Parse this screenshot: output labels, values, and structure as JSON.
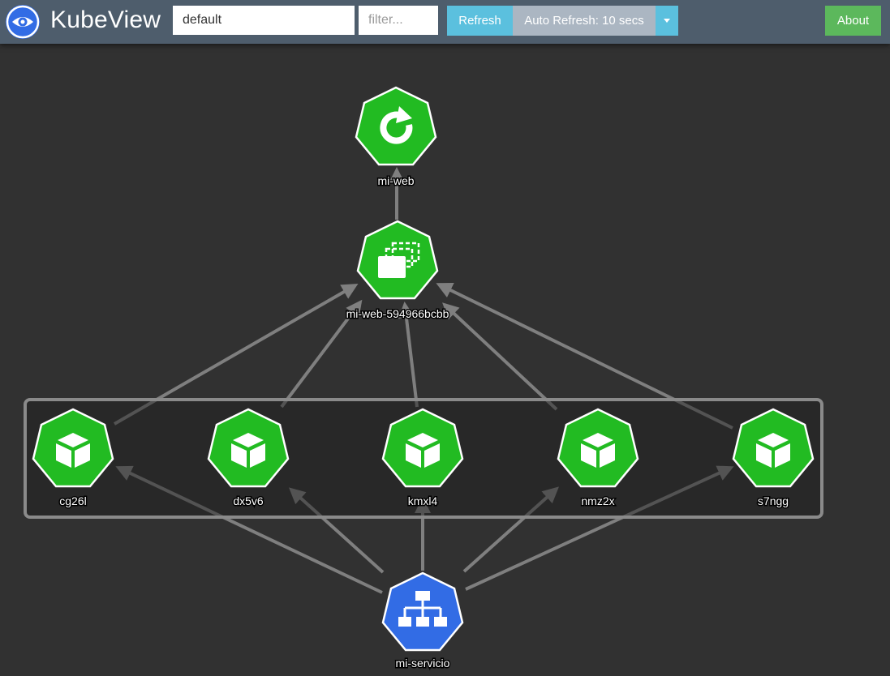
{
  "app": {
    "title": "KubeView",
    "namespace_value": "default",
    "filter_placeholder": "filter...",
    "refresh_label": "Refresh",
    "auto_refresh_label": "Auto Refresh: 10 secs",
    "about_label": "About",
    "logo_icon": "eye-icon"
  },
  "colors": {
    "navbar": "#4e5d6c",
    "canvas": "#313131",
    "node_green": "#22bb22",
    "node_blue": "#326ce5",
    "edge": "#7f7f7f",
    "refresh": "#5bc0de",
    "auto_refresh": "#abb6c2",
    "about": "#5cb85c"
  },
  "graph": {
    "deployment": {
      "label": "mi-web",
      "icon": "refresh-cycle-icon",
      "kind": "deployment"
    },
    "replicaset": {
      "label": "mi-web-594966bcbb",
      "icon": "replicaset-icon",
      "kind": "replicaset"
    },
    "pods": [
      {
        "label": "cg26l",
        "icon": "cube-icon",
        "kind": "pod"
      },
      {
        "label": "dx5v6",
        "icon": "cube-icon",
        "kind": "pod"
      },
      {
        "label": "kmxl4",
        "icon": "cube-icon",
        "kind": "pod"
      },
      {
        "label": "nmz2x",
        "icon": "cube-icon",
        "kind": "pod"
      },
      {
        "label": "s7ngg",
        "icon": "cube-icon",
        "kind": "pod"
      }
    ],
    "service": {
      "label": "mi-servicio",
      "icon": "network-tree-icon",
      "kind": "service"
    }
  }
}
